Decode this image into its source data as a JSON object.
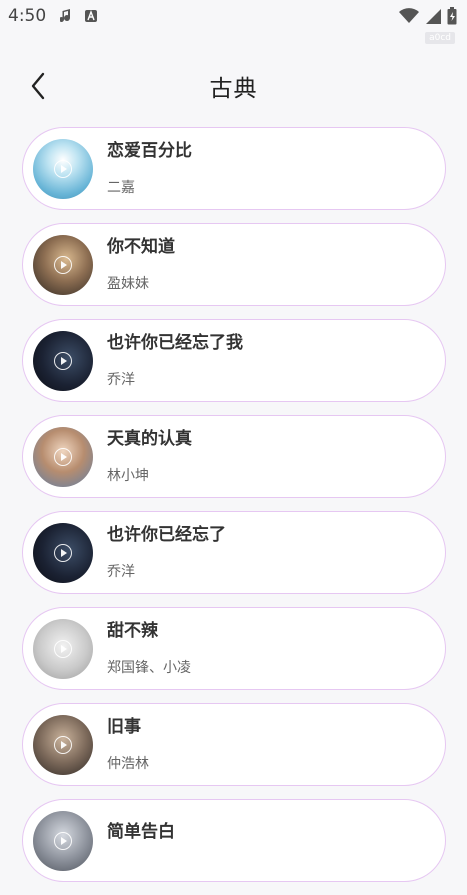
{
  "status": {
    "time": "4:50",
    "badge": "a0cd"
  },
  "header": {
    "title": "古典"
  },
  "songs": [
    {
      "title": "恋爱百分比",
      "artist": "二嘉",
      "avatar_color": "#6fb7d9"
    },
    {
      "title": "你不知道",
      "artist": "盈妹妹",
      "avatar_color": "#7a6a5c"
    },
    {
      "title": "也许你已经忘了我",
      "artist": "乔洋",
      "avatar_color": "#1d1d2a"
    },
    {
      "title": "天真的认真",
      "artist": "林小坤",
      "avatar_color": "#a8876f"
    },
    {
      "title": "也许你已经忘了",
      "artist": "乔洋",
      "avatar_color": "#1d1d2a"
    },
    {
      "title": "甜不辣",
      "artist": "郑国锋、小凌",
      "avatar_color": "#c8c8c8"
    },
    {
      "title": "旧事",
      "artist": "仲浩林",
      "avatar_color": "#5a4d44"
    },
    {
      "title": "简单告白",
      "artist": "",
      "avatar_color": "#8a8f99"
    }
  ]
}
